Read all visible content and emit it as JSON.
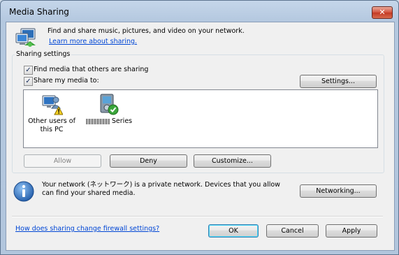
{
  "window": {
    "title": "Media Sharing",
    "close_glyph": "✕"
  },
  "intro": {
    "text": "Find and share music, pictures, and video on your network.",
    "link": "Learn more about sharing."
  },
  "sharing_settings": {
    "label": "Sharing settings",
    "find_media_label": "Find media that others are sharing",
    "find_media_checked": true,
    "share_media_label": "Share my media to:",
    "share_media_checked": true,
    "settings_button": "Settings...",
    "devices": [
      {
        "label_line1": "Other users of",
        "label_line2": "this PC",
        "icon": "users-warning-icon"
      },
      {
        "label": "Series",
        "icon": "media-device-allowed-icon"
      }
    ],
    "allow_button": "Allow",
    "deny_button": "Deny",
    "customize_button": "Customize..."
  },
  "network": {
    "message": "Your network (ネットワーク) is a private network. Devices that you allow can find your shared media.",
    "networking_button": "Networking..."
  },
  "footer": {
    "firewall_link": "How does sharing change firewall settings?",
    "ok_button": "OK",
    "cancel_button": "Cancel",
    "apply_button": "Apply"
  }
}
